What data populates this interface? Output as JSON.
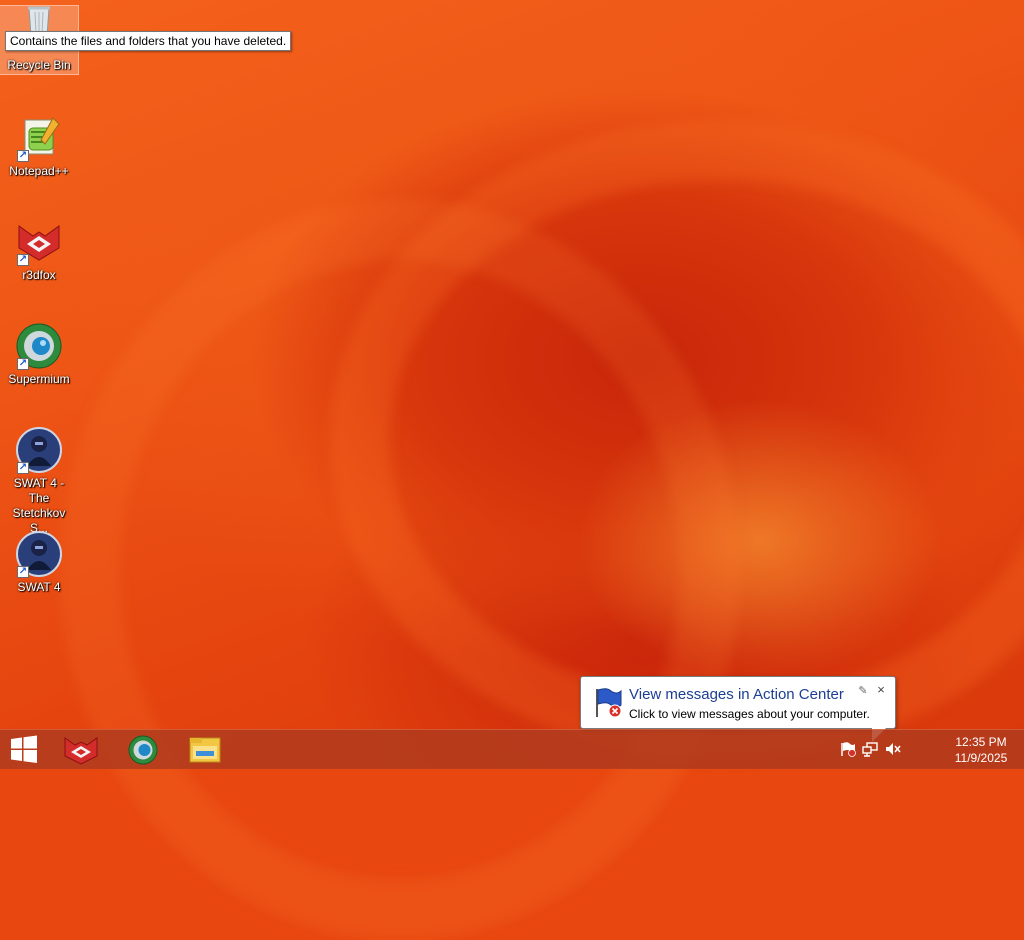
{
  "desktop": {
    "icons": [
      {
        "label": "Recycle Bin",
        "icon": "recycle-bin-icon"
      },
      {
        "label": "Notepad++",
        "icon": "notepad-plus-plus-icon"
      },
      {
        "label": "r3dfox",
        "icon": "r3dfox-icon"
      },
      {
        "label": "Supermium",
        "icon": "supermium-icon"
      },
      {
        "label": "SWAT 4 - The Stetchkov S...",
        "icon": "swat4-stetchkov-icon"
      },
      {
        "label": "SWAT 4",
        "icon": "swat4-icon"
      }
    ],
    "tooltip": "Contains the files and folders that you have deleted."
  },
  "notification": {
    "title": "View messages in Action Center",
    "text": "Click to view messages about your computer.",
    "close_glyph": "×",
    "pin_glyph": "✎"
  },
  "taskbar": {
    "pinned": [
      {
        "name": "r3dfox",
        "icon": "r3dfox-icon"
      },
      {
        "name": "Supermium",
        "icon": "supermium-icon"
      },
      {
        "name": "File Explorer",
        "icon": "file-explorer-icon"
      }
    ],
    "clock": {
      "time": "12:35 PM",
      "date": "11/9/2025"
    }
  },
  "colors": {
    "wallpaper": "#e8470f",
    "taskbar": "#b03c1e",
    "balloon_title": "#1c3f94"
  }
}
